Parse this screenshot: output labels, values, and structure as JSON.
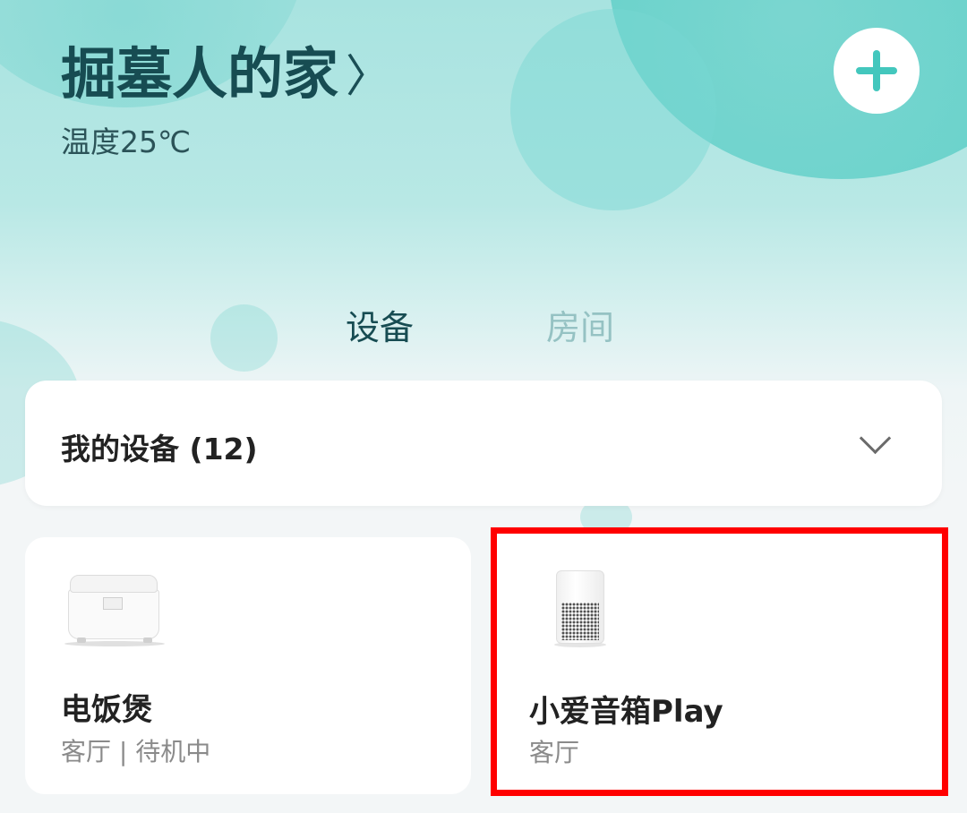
{
  "header": {
    "home_name": "掘墓人的家",
    "home_chevron": "〉",
    "temperature": "温度25℃",
    "add_icon": "plus-icon"
  },
  "tabs": [
    {
      "label": "设备",
      "active": true
    },
    {
      "label": "房间",
      "active": false
    }
  ],
  "device_group": {
    "label": "我的设备 (12)",
    "expand_icon": "chevron-down-icon"
  },
  "devices": [
    {
      "name": "电饭煲",
      "subtitle": "客厅 | 待机中",
      "icon": "rice-cooker-image"
    },
    {
      "name": "小爱音箱Play",
      "subtitle": "客厅",
      "icon": "smart-speaker-image"
    }
  ],
  "colors": {
    "accent": "#43c7bd",
    "title_text": "#174c52",
    "inactive_tab": "#95c2c3",
    "highlight_box": "#ff0000"
  }
}
